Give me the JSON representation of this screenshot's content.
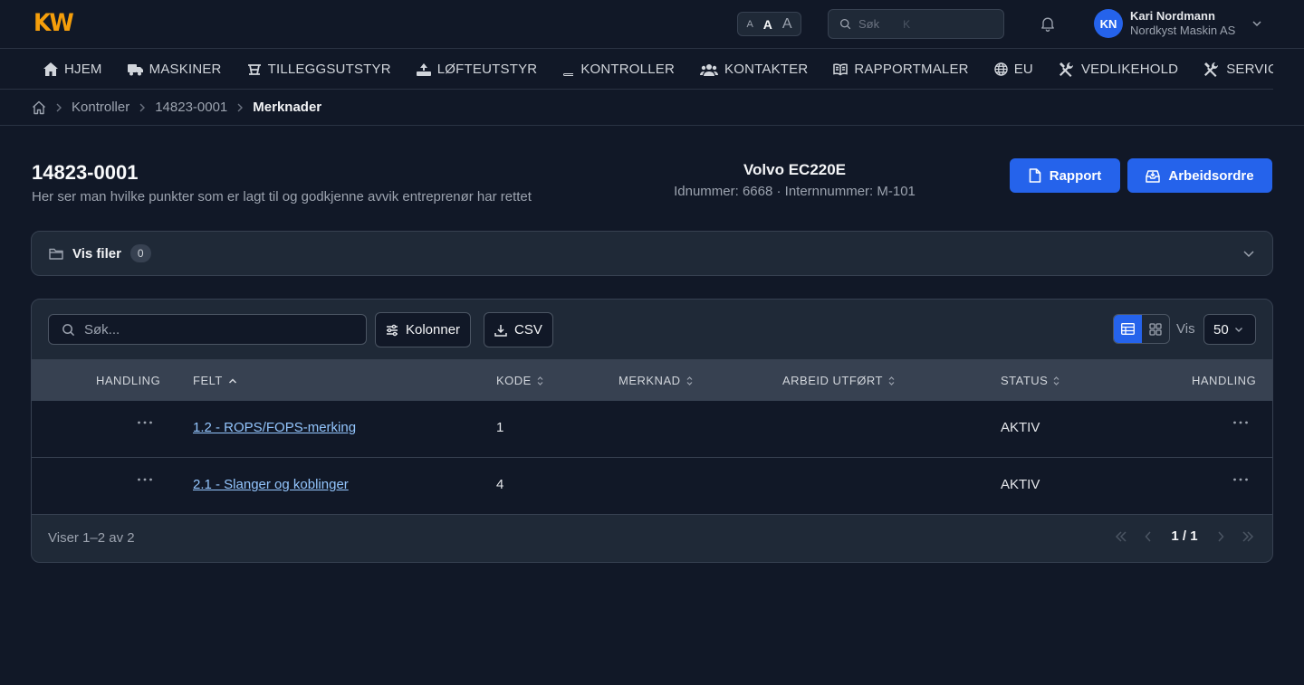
{
  "app": {
    "logo": "KW"
  },
  "topbar": {
    "font_sizes": [
      "A",
      "A",
      "A"
    ],
    "search_placeholder": "Søk",
    "search_shortcut": "K",
    "user": {
      "initials": "KN",
      "name": "Kari Nordmann",
      "company": "Nordkyst Maskin AS"
    }
  },
  "nav": [
    {
      "label": "HJEM",
      "icon": "home-icon"
    },
    {
      "label": "MASKINER",
      "icon": "truck-icon"
    },
    {
      "label": "TILLEGGSUTSTYR",
      "icon": "excavator-icon"
    },
    {
      "label": "LØFTEUTSTYR",
      "icon": "lifting-icon"
    },
    {
      "label": "KONTROLLER",
      "icon": "book-icon"
    },
    {
      "label": "KONTAKTER",
      "icon": "users-icon"
    },
    {
      "label": "RAPPORTMALER",
      "icon": "open-book-icon"
    },
    {
      "label": "EU",
      "icon": "globe-icon"
    },
    {
      "label": "VEDLIKEHOLD",
      "icon": "tools-icon"
    },
    {
      "label": "SERVICE",
      "icon": "tools-icon"
    }
  ],
  "breadcrumb": [
    "Kontroller",
    "14823-0001",
    "Merknader"
  ],
  "header": {
    "title": "14823-0001",
    "subtitle": "Her ser man hvilke punkter som er lagt til og godkjenne avvik entreprenør har rettet",
    "machine_name": "Volvo EC220E",
    "machine_ids": "Idnummer: 6668  ·  Internnummer: M-101",
    "report_button": "Rapport",
    "workorder_button": "Arbeidsordre"
  },
  "files": {
    "label": "Vis filer",
    "count": "0"
  },
  "table": {
    "search_placeholder": "Søk...",
    "columns_button": "Kolonner",
    "csv_button": "CSV",
    "show_label": "Vis",
    "page_size": "50",
    "headers": [
      "HANDLING",
      "FELT",
      "KODE",
      "MERKNAD",
      "ARBEID UTFØRT",
      "STATUS",
      "HANDLING"
    ],
    "rows": [
      {
        "felt": "1.2 - ROPS/FOPS-merking",
        "kode": "1",
        "merknad": "",
        "arbeid": "",
        "status": "AKTIV"
      },
      {
        "felt": "2.1 - Slanger og koblinger",
        "kode": "4",
        "merknad": "",
        "arbeid": "",
        "status": "AKTIV"
      }
    ],
    "showing": "Viser 1–2 av 2",
    "page": "1 / 1"
  },
  "colors": {
    "accent": "#2563eb",
    "logo": "#f59e0b",
    "background": "#111827"
  }
}
